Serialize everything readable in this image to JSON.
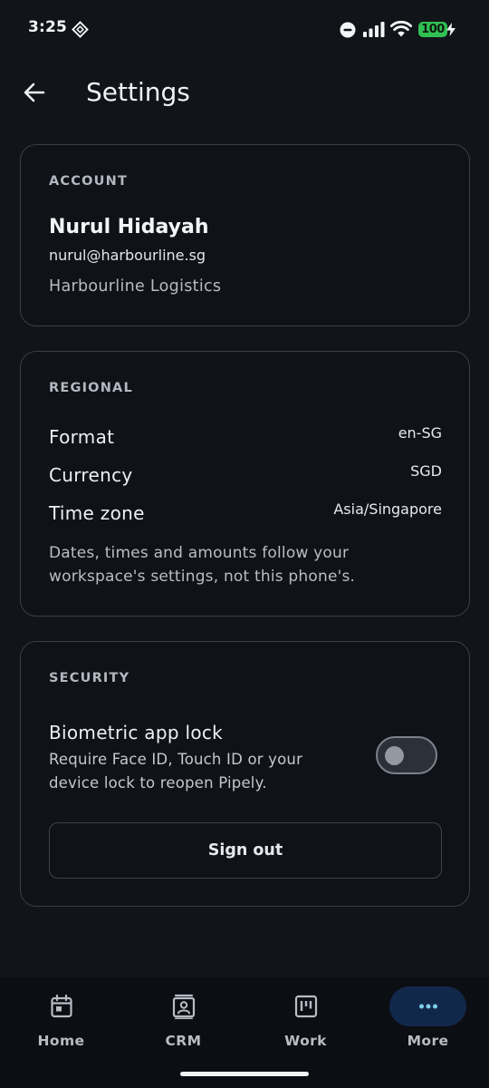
{
  "status_bar": {
    "time": "3:25",
    "battery": "100"
  },
  "header": {
    "title": "Settings"
  },
  "account": {
    "section_label": "ACCOUNT",
    "name": "Nurul Hidayah",
    "email": "nurul@harbourline.sg",
    "organization": "Harbourline Logistics"
  },
  "regional": {
    "section_label": "REGIONAL",
    "rows": [
      {
        "label": "Format",
        "value": "en-SG"
      },
      {
        "label": "Currency",
        "value": "SGD"
      },
      {
        "label": "Time zone",
        "value": "Asia/Singapore"
      }
    ],
    "note": "Dates, times and amounts follow your workspace's settings, not this phone's."
  },
  "security": {
    "section_label": "SECURITY",
    "biometric_title": "Biometric app lock",
    "biometric_description": "Require Face ID, Touch ID or your device lock to reopen Pipely.",
    "biometric_enabled": false,
    "sign_out_label": "Sign out"
  },
  "bottom_nav": {
    "items": [
      {
        "label": "Home",
        "icon": "calendar-icon"
      },
      {
        "label": "CRM",
        "icon": "contacts-icon"
      },
      {
        "label": "Work",
        "icon": "kanban-icon"
      },
      {
        "label": "More",
        "icon": "more-dots-icon",
        "active": true
      }
    ]
  },
  "colors": {
    "background": "#111419",
    "card_border": "#3a3f48",
    "active_pill": "#12284a",
    "active_icon": "#7fd0e8",
    "battery": "#31c053"
  }
}
